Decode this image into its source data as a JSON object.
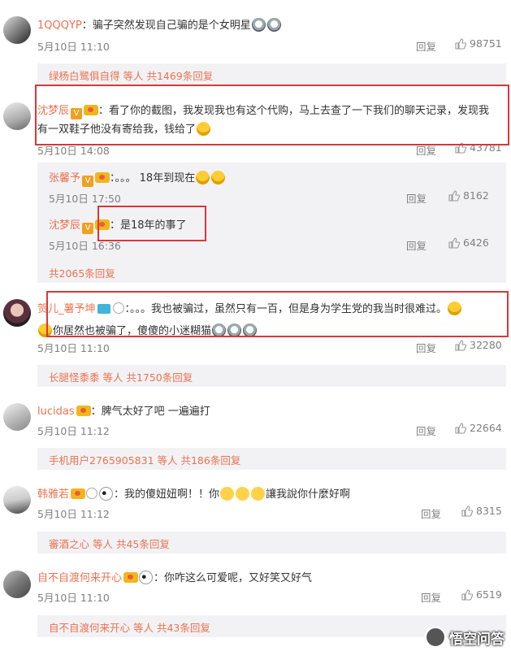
{
  "comments": [
    {
      "name": "1QQQYP",
      "text": "：骗子突然发现自己骗的是个女明星",
      "time": "5月10日 11:10",
      "reply": "回复",
      "likes": "98751",
      "strip": "绿杨白鹭俱自得 等人 共1469条回复"
    },
    {
      "name": "沈梦辰",
      "text": "：看了你的截图，我发现我也有这个代购，马上去查了一下我们的聊天记录，发现我",
      "text2": "有一双鞋子他没有寄给我，钱给了",
      "time": "5月10日 14:08",
      "reply": "回复",
      "likes": "43781"
    },
    {
      "name": "贺儿_薯予坤",
      "text": "：。。。我也被骗过，虽然只有一百，但是身为学生党的我当时很难过。",
      "text2": "你居然也被骗了，傻傻的小迷糊猫",
      "time": "5月10日 11:10",
      "reply": "回复",
      "likes": "32280",
      "strip": "长腿怪黍黍 等人 共1750条回复"
    },
    {
      "name": "lucidas",
      "text": "：脾气太好了吧 一遍遍打",
      "time": "5月10日 11:12",
      "reply": "回复",
      "likes": "22664",
      "strip": "手机用户2765905831 等人 共186条回复"
    },
    {
      "name": "韩雅若",
      "text": "：我的傻妞妞啊！！你",
      "text2": "讓我說你什麼好啊",
      "time": "5月10日 11:12",
      "reply": "回复",
      "likes": "8315",
      "strip": "審酒之心 等人 共45条回复"
    },
    {
      "name": "自不自渡何来开心",
      "text": "：你咋这么可爱呢，又好笑又好气",
      "time": "5月10日 11:10",
      "reply": "回复",
      "likes": "6519",
      "strip": "自不自渡何来开心 等人 共43条回复"
    }
  ],
  "replies": [
    {
      "name": "张馨予",
      "text": "：。。。 18年到现在",
      "time": "5月10日 17:50",
      "reply": "回复",
      "likes": "8162"
    },
    {
      "name": "沈梦辰",
      "text": "：是18年的事了",
      "time": "5月10日 16:36",
      "reply": "回复",
      "likes": "6426"
    }
  ],
  "reply_total": "共2065条回复",
  "watermark": "悟空问答",
  "colors": {
    "name": "#eb7350",
    "highlight": "#d9373a",
    "strip": "#f2f2f5"
  }
}
